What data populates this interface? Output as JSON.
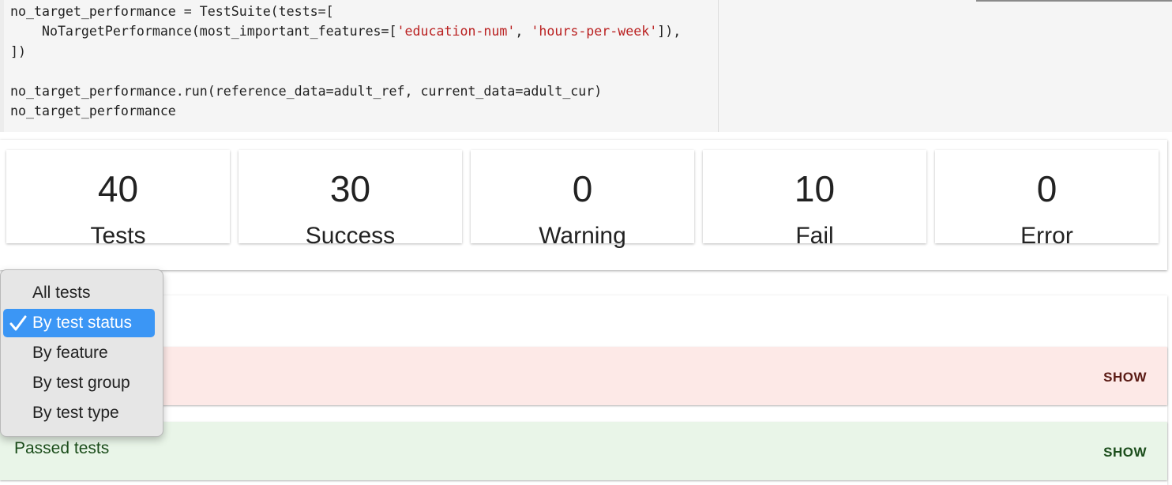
{
  "code": {
    "line1_a": "no_target_performance = TestSuite(tests=[",
    "line2_a": "    NoTargetPerformance(most_important_features=[",
    "line2_s1": "'education-num'",
    "line2_sep": ", ",
    "line2_s2": "'hours-per-week'",
    "line2_b": "]),",
    "line3": "])",
    "line4": "",
    "line5": "no_target_performance.run(reference_data=adult_ref, current_data=adult_cur)",
    "line6": "no_target_performance"
  },
  "summary": [
    {
      "value": "40",
      "label": "Tests"
    },
    {
      "value": "30",
      "label": "Success"
    },
    {
      "value": "0",
      "label": "Warning"
    },
    {
      "value": "10",
      "label": "Fail"
    },
    {
      "value": "0",
      "label": "Error"
    }
  ],
  "menu": {
    "items": [
      {
        "label": "All tests"
      },
      {
        "label": "By test status"
      },
      {
        "label": "By feature"
      },
      {
        "label": "By test group"
      },
      {
        "label": "By test type"
      }
    ],
    "selected_label": "By test status"
  },
  "groups": {
    "failed": {
      "title": "",
      "action": "SHOW"
    },
    "passed": {
      "title": "Passed tests",
      "action": "SHOW"
    }
  },
  "colors": {
    "code_string": "#ba2121",
    "menu_selected": "#3b96f5",
    "failed_bg": "#fde9e7",
    "passed_bg": "#e9f5e8"
  },
  "icons": {
    "selected_item": "checkmark-icon"
  }
}
